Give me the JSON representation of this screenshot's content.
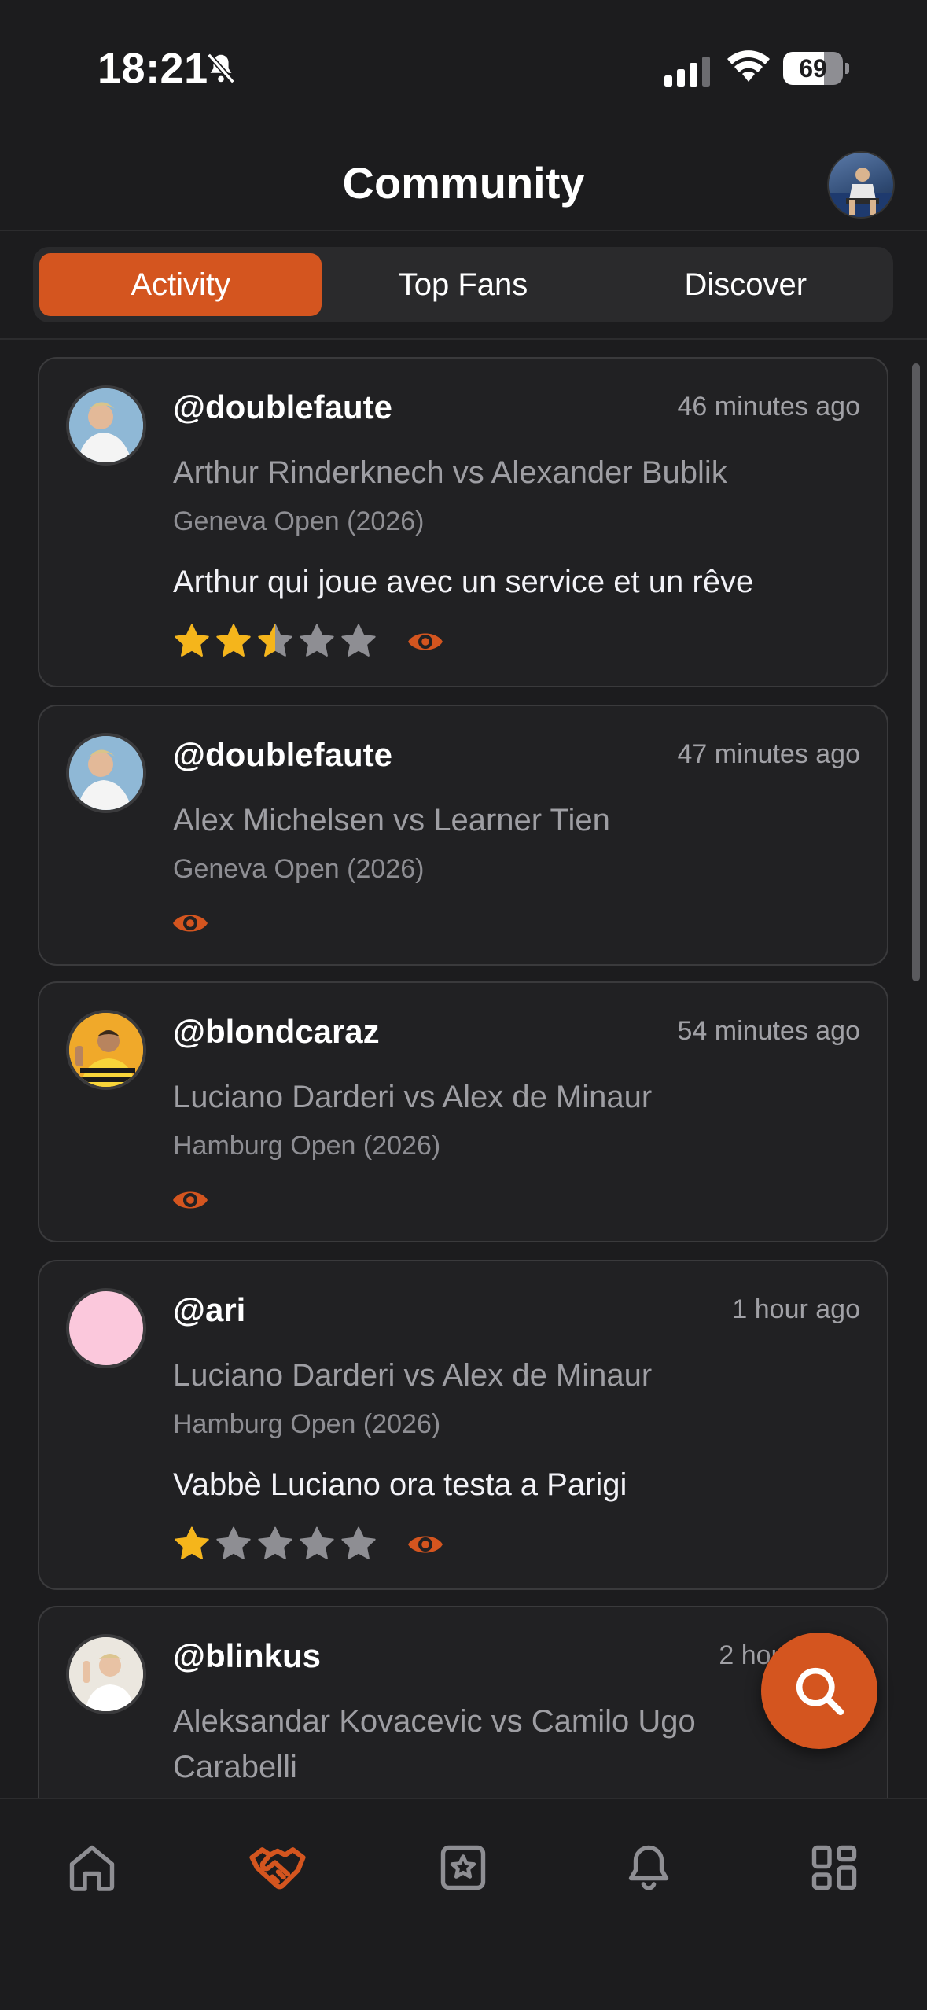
{
  "status_bar": {
    "time": "18:21",
    "battery": "69",
    "battery_level": 0.69
  },
  "header": {
    "title": "Community"
  },
  "tabs": [
    {
      "label": "Activity",
      "active": true
    },
    {
      "label": "Top Fans",
      "active": false
    },
    {
      "label": "Discover",
      "active": false
    }
  ],
  "feed": [
    {
      "username": "@doublefaute",
      "time": "46 minutes ago",
      "match": "Arthur Rinderknech vs Alexander Bublik",
      "tournament": "Geneva Open (2026)",
      "comment": "Arthur qui joue avec un service et un rêve",
      "rating": 2.5,
      "rating_max": 5
    },
    {
      "username": "@doublefaute",
      "time": "47 minutes ago",
      "match": "Alex Michelsen vs Learner Tien",
      "tournament": "Geneva Open (2026)"
    },
    {
      "username": "@blondcaraz",
      "time": "54 minutes ago",
      "match": "Luciano Darderi vs Alex de Minaur",
      "tournament": "Hamburg Open (2026)"
    },
    {
      "username": "@ari",
      "time": "1 hour ago",
      "match": "Luciano Darderi vs Alex de Minaur",
      "tournament": "Hamburg Open (2026)",
      "comment": "Vabbè Luciano ora testa a Parigi",
      "rating": 1,
      "rating_max": 5
    },
    {
      "username": "@blinkus",
      "time": "2 hours ago",
      "match": "Aleksandar Kovacevic vs Camilo Ugo Carabelli"
    }
  ],
  "bottom_nav": [
    {
      "icon": "home-icon",
      "active": false
    },
    {
      "icon": "handshake-icon",
      "active": true
    },
    {
      "icon": "star-square-icon",
      "active": false
    },
    {
      "icon": "bell-icon",
      "active": false
    },
    {
      "icon": "grid-icon",
      "active": false
    }
  ],
  "colors": {
    "accent": "#d4551f",
    "star": "#f5b51b",
    "star_empty": "#8e8e93",
    "background": "#1c1c1e",
    "card": "#212123"
  }
}
